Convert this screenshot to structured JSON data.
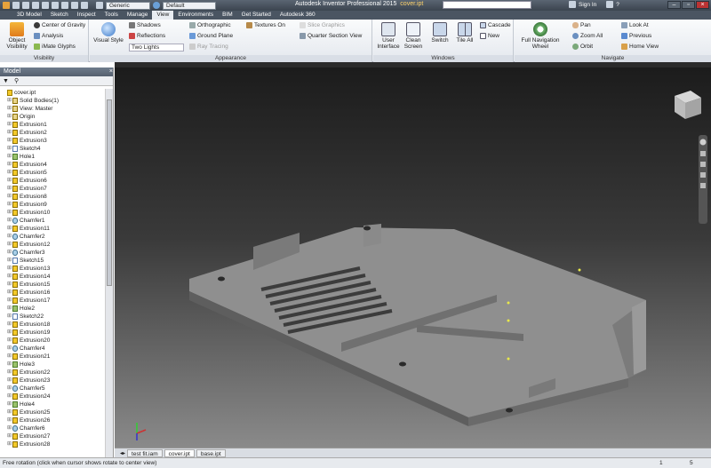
{
  "titlebar": {
    "material": "Generic",
    "appearance": "Default",
    "app_title": "Autodesk Inventor Professional 2015",
    "document": "cover.ipt",
    "sign_in": "Sign In",
    "help": "?"
  },
  "menu_tabs": [
    "3D Model",
    "Sketch",
    "Inspect",
    "Tools",
    "Manage",
    "View",
    "Environments",
    "BIM",
    "Get Started",
    "Autodesk 360"
  ],
  "ribbon": {
    "visibility": {
      "object_visibility": "Object Visibility",
      "center_of_gravity": "Center of Gravity",
      "analysis": "Analysis",
      "imate_glyphs": "iMate Glyphs",
      "label": "Visibility"
    },
    "appearance": {
      "visual_style": "Visual Style",
      "shadows": "Shadows",
      "reflections": "Reflections",
      "lights": "Two Lights",
      "orthographic": "Orthographic",
      "ground_plane": "Ground Plane",
      "ray_tracing": "Ray Tracing",
      "textures_on": "Textures On",
      "slice_graphics": "Slice Graphics",
      "quarter_section": "Quarter Section View",
      "label": "Appearance"
    },
    "windows": {
      "user_interface": "User Interface",
      "clean_screen": "Clean Screen",
      "switch": "Switch",
      "tile_all": "Tile All",
      "cascade": "Cascade",
      "new": "New",
      "label": "Windows"
    },
    "navigate": {
      "full_nav_wheel": "Full Navigation Wheel",
      "pan": "Pan",
      "zoom_all": "Zoom All",
      "orbit": "Orbit",
      "look_at": "Look At",
      "previous": "Previous",
      "home_view": "Home View",
      "label": "Navigate"
    }
  },
  "model_panel": {
    "title": "Model",
    "items": [
      {
        "label": "cover.ipt",
        "type": "part",
        "indent": 0
      },
      {
        "label": "Solid Bodies(1)",
        "type": "folder",
        "indent": 1
      },
      {
        "label": "View: Master",
        "type": "folder",
        "indent": 1
      },
      {
        "label": "Origin",
        "type": "folder",
        "indent": 1
      },
      {
        "label": "Extrusion1",
        "type": "ext",
        "indent": 1
      },
      {
        "label": "Extrusion2",
        "type": "ext",
        "indent": 1
      },
      {
        "label": "Extrusion3",
        "type": "ext",
        "indent": 1
      },
      {
        "label": "Sketch4",
        "type": "sk",
        "indent": 1
      },
      {
        "label": "Hole1",
        "type": "hole",
        "indent": 1
      },
      {
        "label": "Extrusion4",
        "type": "ext",
        "indent": 1
      },
      {
        "label": "Extrusion5",
        "type": "ext",
        "indent": 1
      },
      {
        "label": "Extrusion6",
        "type": "ext",
        "indent": 1
      },
      {
        "label": "Extrusion7",
        "type": "ext",
        "indent": 1
      },
      {
        "label": "Extrusion8",
        "type": "ext",
        "indent": 1
      },
      {
        "label": "Extrusion9",
        "type": "ext",
        "indent": 1
      },
      {
        "label": "Extrusion10",
        "type": "ext",
        "indent": 1
      },
      {
        "label": "Chamfer1",
        "type": "ch",
        "indent": 1
      },
      {
        "label": "Extrusion11",
        "type": "ext",
        "indent": 1
      },
      {
        "label": "Chamfer2",
        "type": "ch",
        "indent": 1
      },
      {
        "label": "Extrusion12",
        "type": "ext",
        "indent": 1
      },
      {
        "label": "Chamfer3",
        "type": "ch",
        "indent": 1
      },
      {
        "label": "Sketch15",
        "type": "sk",
        "indent": 1
      },
      {
        "label": "Extrusion13",
        "type": "ext",
        "indent": 1
      },
      {
        "label": "Extrusion14",
        "type": "ext",
        "indent": 1
      },
      {
        "label": "Extrusion15",
        "type": "ext",
        "indent": 1
      },
      {
        "label": "Extrusion16",
        "type": "ext",
        "indent": 1
      },
      {
        "label": "Extrusion17",
        "type": "ext",
        "indent": 1
      },
      {
        "label": "Hole2",
        "type": "hole",
        "indent": 1
      },
      {
        "label": "Sketch22",
        "type": "sk",
        "indent": 1
      },
      {
        "label": "Extrusion18",
        "type": "ext",
        "indent": 1
      },
      {
        "label": "Extrusion19",
        "type": "ext",
        "indent": 1
      },
      {
        "label": "Extrusion20",
        "type": "ext",
        "indent": 1
      },
      {
        "label": "Chamfer4",
        "type": "ch",
        "indent": 1
      },
      {
        "label": "Extrusion21",
        "type": "ext",
        "indent": 1
      },
      {
        "label": "Hole3",
        "type": "hole",
        "indent": 1
      },
      {
        "label": "Extrusion22",
        "type": "ext",
        "indent": 1
      },
      {
        "label": "Extrusion23",
        "type": "ext",
        "indent": 1
      },
      {
        "label": "Chamfer5",
        "type": "ch",
        "indent": 1
      },
      {
        "label": "Extrusion24",
        "type": "ext",
        "indent": 1
      },
      {
        "label": "Hole4",
        "type": "hole",
        "indent": 1
      },
      {
        "label": "Extrusion25",
        "type": "ext",
        "indent": 1
      },
      {
        "label": "Extrusion26",
        "type": "ext",
        "indent": 1
      },
      {
        "label": "Chamfer6",
        "type": "ch",
        "indent": 1
      },
      {
        "label": "Extrusion27",
        "type": "ext",
        "indent": 1
      },
      {
        "label": "Extrusion28",
        "type": "ext",
        "indent": 1
      }
    ]
  },
  "doc_tabs": [
    {
      "label": "test fit.iam",
      "active": false
    },
    {
      "label": "cover.ipt",
      "active": true
    },
    {
      "label": "base.ipt",
      "active": false
    }
  ],
  "status": {
    "message": "Free rotation (click when cursor shows rotate to center view)",
    "count1": "1",
    "count2": "5"
  },
  "colors": {
    "accent": "#4a5562",
    "part_face": "#8c8c8c",
    "highlight": "#e8e84a"
  }
}
